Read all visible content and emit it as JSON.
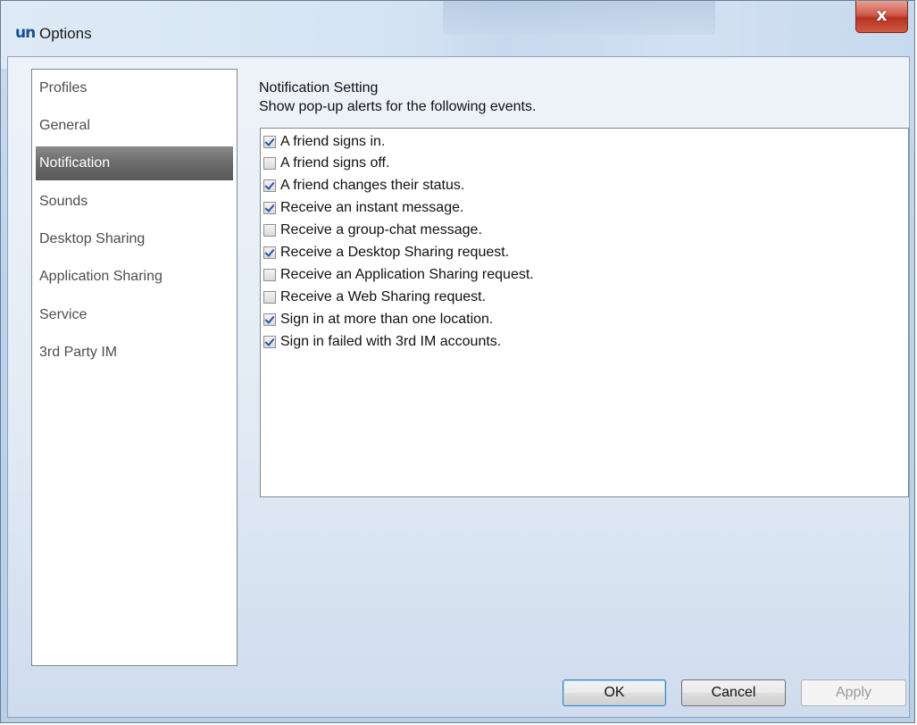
{
  "window": {
    "app_icon_text": "un",
    "title": "Options",
    "close_label": "x"
  },
  "sidebar": {
    "items": [
      {
        "label": "Profiles",
        "active": false
      },
      {
        "label": "General",
        "active": false
      },
      {
        "label": "Notification",
        "active": true
      },
      {
        "label": "Sounds",
        "active": false
      },
      {
        "label": "Desktop Sharing",
        "active": false
      },
      {
        "label": "Application  Sharing",
        "active": false
      },
      {
        "label": "Service",
        "active": false
      },
      {
        "label": "3rd Party IM",
        "active": false
      }
    ]
  },
  "main": {
    "heading": "Notification Setting",
    "subheading": "Show pop-up alerts for the following events.",
    "options": [
      {
        "label": "A friend signs in.",
        "checked": true
      },
      {
        "label": "A friend signs off.",
        "checked": false
      },
      {
        "label": "A friend changes their status.",
        "checked": true
      },
      {
        "label": "Receive an instant message.",
        "checked": true
      },
      {
        "label": "Receive a group-chat message.",
        "checked": false
      },
      {
        "label": "Receive a Desktop Sharing request.",
        "checked": true
      },
      {
        "label": "Receive an Application Sharing request.",
        "checked": false
      },
      {
        "label": "Receive a Web Sharing request.",
        "checked": false
      },
      {
        "label": "Sign in at more than one location.",
        "checked": true
      },
      {
        "label": "Sign in failed with 3rd IM accounts.",
        "checked": true
      }
    ]
  },
  "buttons": {
    "ok": "OK",
    "cancel": "Cancel",
    "apply": "Apply",
    "apply_enabled": false
  }
}
